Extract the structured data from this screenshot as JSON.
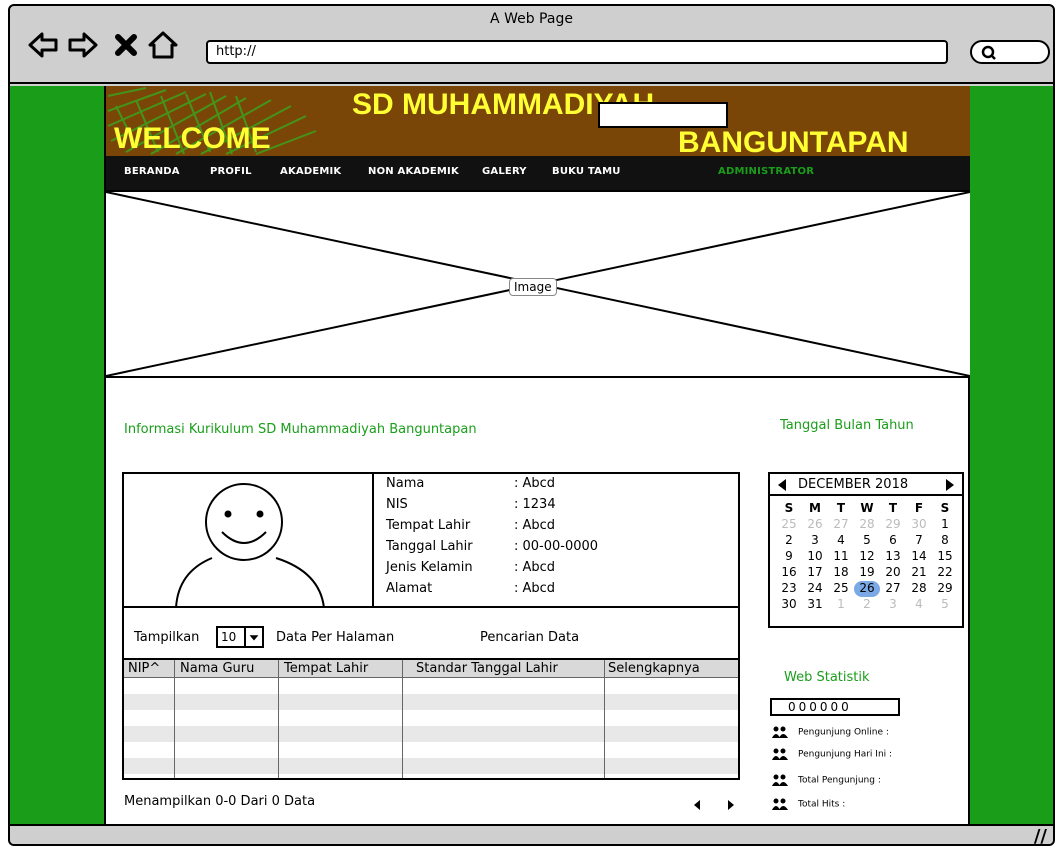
{
  "window": {
    "title": "A Web Page",
    "url": "http://"
  },
  "site": {
    "welcome": "WELCOME",
    "title_line1": "SD MUHAMMADIYAH",
    "title_line2": "BANGUNTAPAN"
  },
  "menu": {
    "items": [
      "BERANDA",
      "PROFIL",
      "AKADEMIK",
      "NON AKADEMIK",
      "GALERY",
      "BUKU TAMU"
    ],
    "admin": "ADMINISTRATOR"
  },
  "banner": {
    "label": "Image"
  },
  "main": {
    "title": "Informasi Kurikulum SD Muhammadiyah Banguntapan"
  },
  "profile": {
    "fields": [
      {
        "label": "Nama",
        "value": ": Abcd"
      },
      {
        "label": "NIS",
        "value": ": 1234"
      },
      {
        "label": "Tempat Lahir",
        "value": ": Abcd"
      },
      {
        "label": "Tanggal Lahir",
        "value": ": 00-00-0000"
      },
      {
        "label": "Jenis Kelamin",
        "value": ": Abcd"
      },
      {
        "label": "Alamat",
        "value": ": Abcd"
      }
    ]
  },
  "controls": {
    "show_label": "Tampilkan",
    "page_size": "10",
    "per_page_label": "Data Per Halaman",
    "search_label": "Pencarian Data"
  },
  "table": {
    "headers": [
      "NIP^",
      "Nama Guru",
      "Tempat Lahir",
      "Standar Tanggal Lahir",
      "Selengkapnya"
    ]
  },
  "footer": {
    "showing": "Menampilkan 0-0 Dari 0 Data"
  },
  "sidebar": {
    "date_title": "Tanggal Bulan Tahun",
    "calendar": {
      "month": "DECEMBER 2018",
      "days": [
        "S",
        "M",
        "T",
        "W",
        "T",
        "F",
        "S"
      ],
      "weeks": [
        [
          "25",
          "26",
          "27",
          "28",
          "29",
          "30",
          "1"
        ],
        [
          "2",
          "3",
          "4",
          "5",
          "6",
          "7",
          "8"
        ],
        [
          "9",
          "10",
          "11",
          "12",
          "13",
          "14",
          "15"
        ],
        [
          "16",
          "17",
          "18",
          "19",
          "20",
          "21",
          "22"
        ],
        [
          "23",
          "24",
          "25",
          "26",
          "27",
          "28",
          "29"
        ],
        [
          "30",
          "31",
          "1",
          "2",
          "3",
          "4",
          "5"
        ]
      ],
      "selected": "26"
    },
    "stats_title": "Web Statistik",
    "counter": "000000",
    "stats": [
      "Pengunjung Online :",
      "Pengunjung Hari Ini :",
      "Total Pengunjung :",
      "Total Hits :"
    ]
  },
  "colors": {
    "accent": "#1a9e1a",
    "header": "#7a4608",
    "title": "#ffff33",
    "menubar": "#111111"
  }
}
